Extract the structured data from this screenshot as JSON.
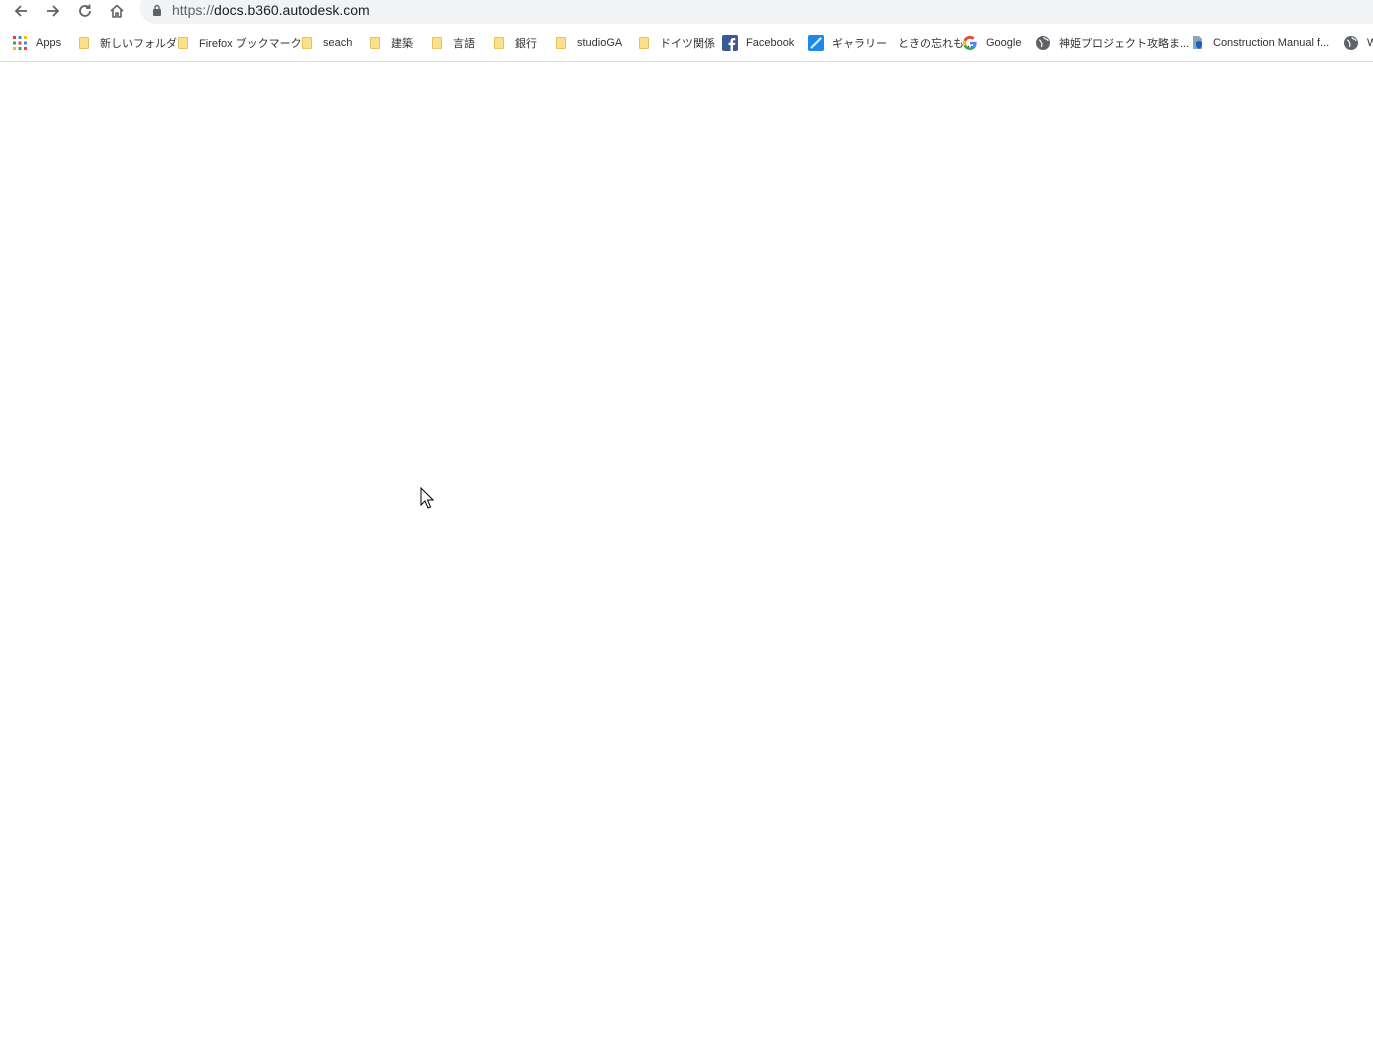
{
  "browser": {
    "url_scheme": "https://",
    "url_host": "docs.b360.autodesk.com"
  },
  "bookmarks": [
    {
      "label": "Apps",
      "icon": "apps-grid-icon"
    },
    {
      "label": "新しいフォルダ",
      "icon": "folder-icon"
    },
    {
      "label": "Firefox ブックマーク",
      "icon": "folder-icon"
    },
    {
      "label": "seach",
      "icon": "folder-icon"
    },
    {
      "label": "建築",
      "icon": "folder-icon"
    },
    {
      "label": "言語",
      "icon": "folder-icon"
    },
    {
      "label": "銀行",
      "icon": "folder-icon"
    },
    {
      "label": "studioGA",
      "icon": "folder-icon"
    },
    {
      "label": "ドイツ関係",
      "icon": "folder-icon"
    },
    {
      "label": "Facebook",
      "icon": "facebook-icon"
    },
    {
      "label": "ギャラリー　ときの忘れも...",
      "icon": "gallery-icon"
    },
    {
      "label": "Google",
      "icon": "google-icon"
    },
    {
      "label": "神姫プロジェクト攻略ま...",
      "icon": "globe-icon"
    },
    {
      "label": "Construction Manual f...",
      "icon": "document-shield-icon"
    },
    {
      "label": "W",
      "icon": "globe-icon"
    }
  ],
  "colors": {
    "omnibox_bg": "#f1f3f4",
    "folder": "#fbe08a",
    "facebook": "#3b5998",
    "page_bg": "#ffffff"
  }
}
